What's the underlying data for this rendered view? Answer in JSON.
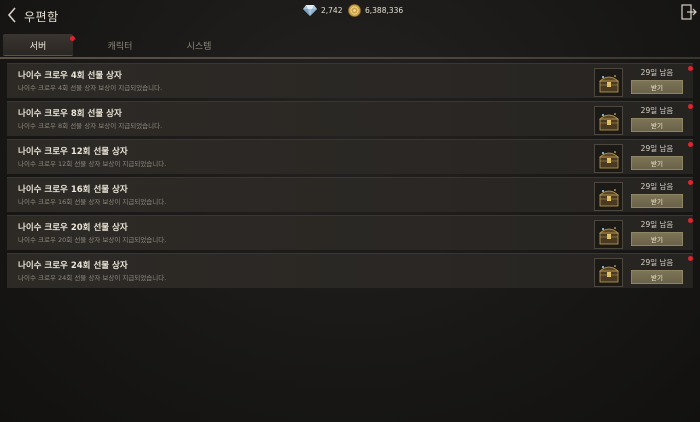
{
  "header": {
    "title": "우편함",
    "diamond": "2,742",
    "gold": "6,388,336"
  },
  "tabs": [
    {
      "label": "서버",
      "active": true,
      "has_new": true
    },
    {
      "label": "캐릭터",
      "active": false,
      "has_new": false
    },
    {
      "label": "시스템",
      "active": false,
      "has_new": false
    }
  ],
  "mails": [
    {
      "title": "나이수 크로우 4회 선물 상자",
      "desc": "나이수 크로우 4회 선물 상자 보상이 지급되었습니다.",
      "days": "29일 남음",
      "button": "받기",
      "has_new": true
    },
    {
      "title": "나이수 크로우 8회 선물 상자",
      "desc": "나이수 크로우 8회 선물 상자 보상이 지급되었습니다.",
      "days": "29일 남음",
      "button": "받기",
      "has_new": true
    },
    {
      "title": "나이수 크로우 12회 선물 상자",
      "desc": "나이수 크로우 12회 선물 상자 보상이 지급되었습니다.",
      "days": "29일 남음",
      "button": "받기",
      "has_new": true
    },
    {
      "title": "나이수 크로우 16회 선물 상자",
      "desc": "나이수 크로우 16회 선물 상자 보상이 지급되었습니다.",
      "days": "29일 남음",
      "button": "받기",
      "has_new": true
    },
    {
      "title": "나이수 크로우 20회 선물 상자",
      "desc": "나이수 크로우 20회 선물 상자 보상이 지급되었습니다.",
      "days": "29일 남음",
      "button": "받기",
      "has_new": true
    },
    {
      "title": "나이수 크로우 24회 선물 상자",
      "desc": "나이수 크로우 24회 선물 상자 보상이 지급되었습니다.",
      "days": "29일 남음",
      "button": "받기",
      "has_new": true
    }
  ],
  "colors": {
    "accent_red": "#e0242e",
    "button_gold": "#7d7456"
  },
  "icons": {
    "back": "chevron-left-icon",
    "diamond": "diamond-icon",
    "gold": "gold-coin-icon",
    "exit": "exit-icon",
    "item": "treasure-chest-icon"
  }
}
